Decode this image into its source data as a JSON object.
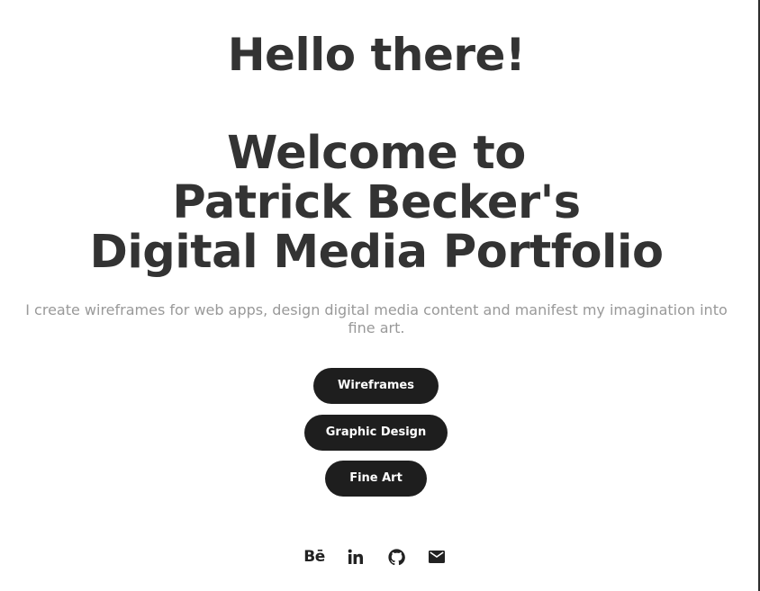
{
  "hero": {
    "greeting": "Hello there!",
    "welcome_lines": [
      "Welcome to",
      "Patrick Becker's",
      "Digital Media Portfolio"
    ],
    "intro": "I create wireframes for web apps, design digital media content and manifest my imagination into fine art."
  },
  "nav_buttons": [
    {
      "label": "Wireframes"
    },
    {
      "label": "Graphic Design"
    },
    {
      "label": "Fine Art"
    }
  ],
  "social_links": [
    {
      "icon": "behance-icon",
      "glyph": "Bē"
    },
    {
      "icon": "linkedin-icon"
    },
    {
      "icon": "github-icon"
    },
    {
      "icon": "mail-icon"
    }
  ],
  "colors": {
    "heading": "#333333",
    "intro_text": "#999999",
    "button_bg": "#1e1e1e",
    "button_text": "#ffffff",
    "background": "#ffffff"
  }
}
